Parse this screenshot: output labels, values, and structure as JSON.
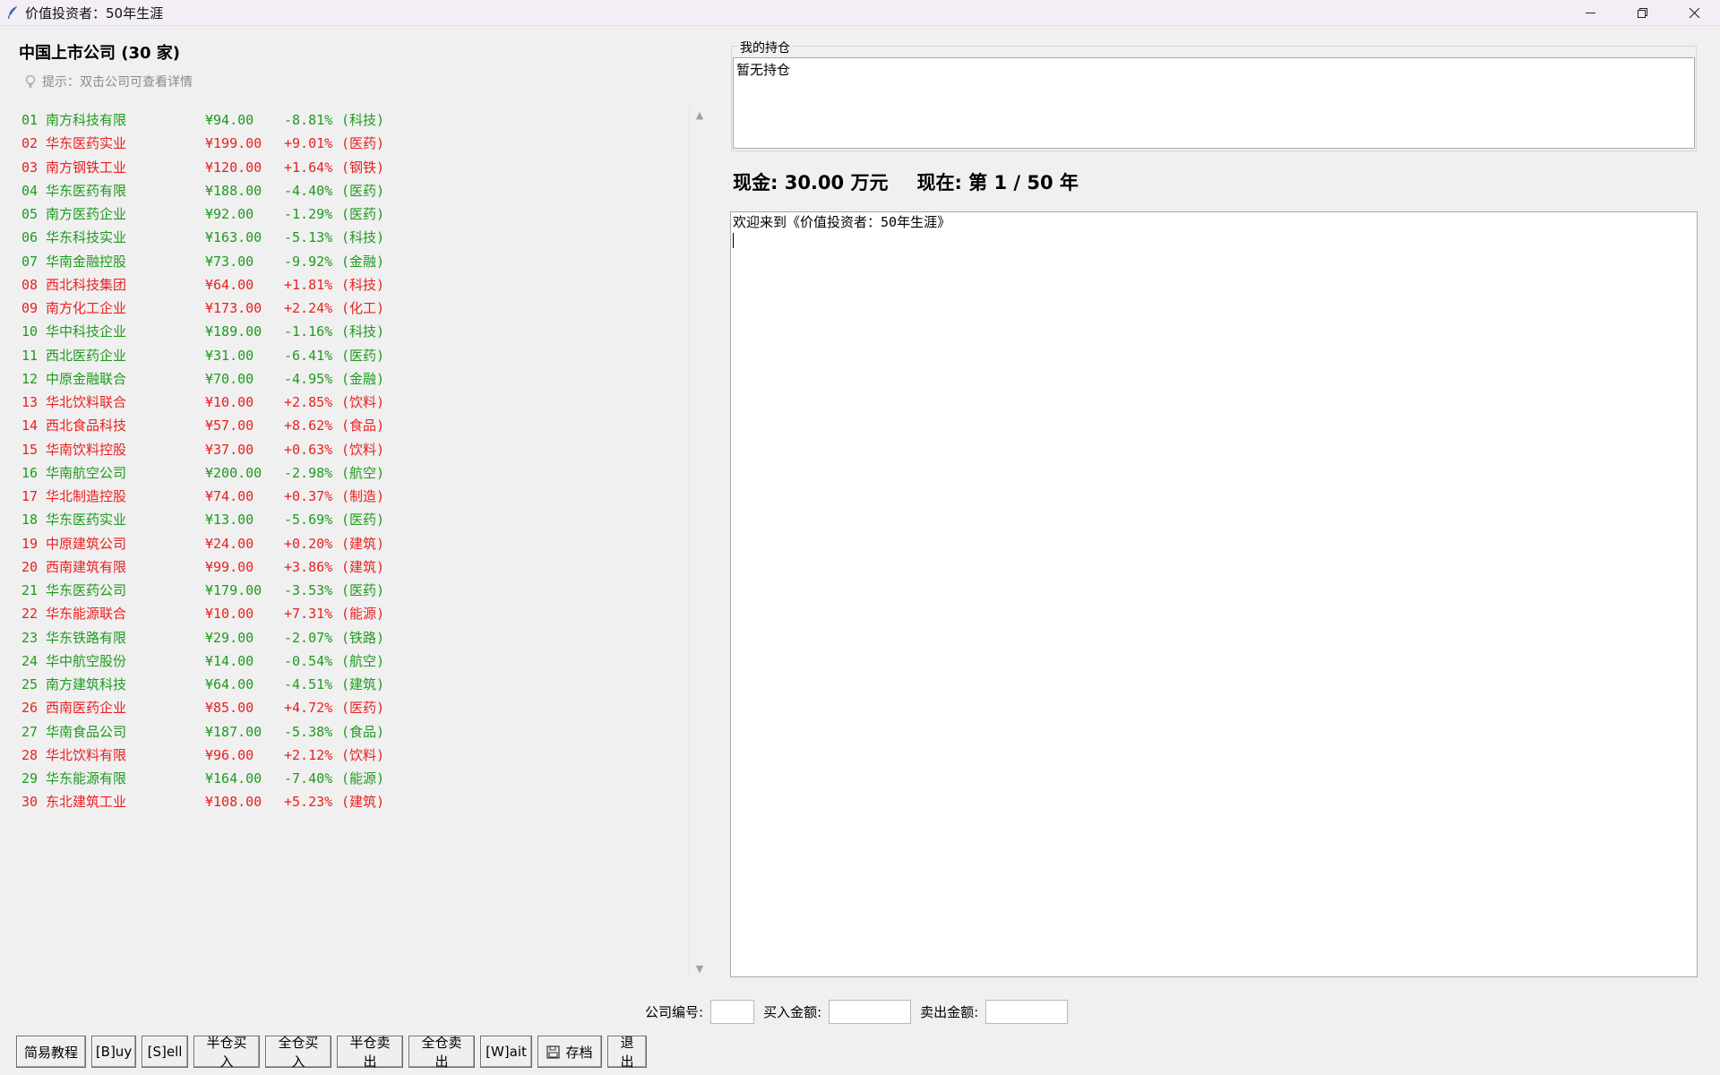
{
  "window": {
    "title": "价值投资者：50年生涯",
    "controls": {
      "minimize": "─",
      "maximize": "❐",
      "close": "✕"
    }
  },
  "list": {
    "title": "中国上市公司 (30 家)",
    "hint": "提示：双击公司可查看详情"
  },
  "companies": [
    {
      "code": "01",
      "name": "南方科技有限",
      "price": "¥94.00",
      "change": "-8.81%",
      "sector": "(科技)",
      "dir": "down"
    },
    {
      "code": "02",
      "name": "华东医药实业",
      "price": "¥199.00",
      "change": "+9.01%",
      "sector": "(医药)",
      "dir": "up"
    },
    {
      "code": "03",
      "name": "南方钢铁工业",
      "price": "¥120.00",
      "change": "+1.64%",
      "sector": "(钢铁)",
      "dir": "up"
    },
    {
      "code": "04",
      "name": "华东医药有限",
      "price": "¥188.00",
      "change": "-4.40%",
      "sector": "(医药)",
      "dir": "down"
    },
    {
      "code": "05",
      "name": "南方医药企业",
      "price": "¥92.00",
      "change": "-1.29%",
      "sector": "(医药)",
      "dir": "down"
    },
    {
      "code": "06",
      "name": "华东科技实业",
      "price": "¥163.00",
      "change": "-5.13%",
      "sector": "(科技)",
      "dir": "down"
    },
    {
      "code": "07",
      "name": "华南金融控股",
      "price": "¥73.00",
      "change": "-9.92%",
      "sector": "(金融)",
      "dir": "down"
    },
    {
      "code": "08",
      "name": "西北科技集团",
      "price": "¥64.00",
      "change": "+1.81%",
      "sector": "(科技)",
      "dir": "up"
    },
    {
      "code": "09",
      "name": "南方化工企业",
      "price": "¥173.00",
      "change": "+2.24%",
      "sector": "(化工)",
      "dir": "up"
    },
    {
      "code": "10",
      "name": "华中科技企业",
      "price": "¥189.00",
      "change": "-1.16%",
      "sector": "(科技)",
      "dir": "down"
    },
    {
      "code": "11",
      "name": "西北医药企业",
      "price": "¥31.00",
      "change": "-6.41%",
      "sector": "(医药)",
      "dir": "down"
    },
    {
      "code": "12",
      "name": "中原金融联合",
      "price": "¥70.00",
      "change": "-4.95%",
      "sector": "(金融)",
      "dir": "down"
    },
    {
      "code": "13",
      "name": "华北饮料联合",
      "price": "¥10.00",
      "change": "+2.85%",
      "sector": "(饮料)",
      "dir": "up"
    },
    {
      "code": "14",
      "name": "西北食品科技",
      "price": "¥57.00",
      "change": "+8.62%",
      "sector": "(食品)",
      "dir": "up"
    },
    {
      "code": "15",
      "name": "华南饮料控股",
      "price": "¥37.00",
      "change": "+0.63%",
      "sector": "(饮料)",
      "dir": "up"
    },
    {
      "code": "16",
      "name": "华南航空公司",
      "price": "¥200.00",
      "change": "-2.98%",
      "sector": "(航空)",
      "dir": "down"
    },
    {
      "code": "17",
      "name": "华北制造控股",
      "price": "¥74.00",
      "change": "+0.37%",
      "sector": "(制造)",
      "dir": "up"
    },
    {
      "code": "18",
      "name": "华东医药实业",
      "price": "¥13.00",
      "change": "-5.69%",
      "sector": "(医药)",
      "dir": "down"
    },
    {
      "code": "19",
      "name": "中原建筑公司",
      "price": "¥24.00",
      "change": "+0.20%",
      "sector": "(建筑)",
      "dir": "up"
    },
    {
      "code": "20",
      "name": "西南建筑有限",
      "price": "¥99.00",
      "change": "+3.86%",
      "sector": "(建筑)",
      "dir": "up"
    },
    {
      "code": "21",
      "name": "华东医药公司",
      "price": "¥179.00",
      "change": "-3.53%",
      "sector": "(医药)",
      "dir": "down"
    },
    {
      "code": "22",
      "name": "华东能源联合",
      "price": "¥10.00",
      "change": "+7.31%",
      "sector": "(能源)",
      "dir": "up"
    },
    {
      "code": "23",
      "name": "华东铁路有限",
      "price": "¥29.00",
      "change": "-2.07%",
      "sector": "(铁路)",
      "dir": "down"
    },
    {
      "code": "24",
      "name": "华中航空股份",
      "price": "¥14.00",
      "change": "-0.54%",
      "sector": "(航空)",
      "dir": "down"
    },
    {
      "code": "25",
      "name": "南方建筑科技",
      "price": "¥64.00",
      "change": "-4.51%",
      "sector": "(建筑)",
      "dir": "down"
    },
    {
      "code": "26",
      "name": "西南医药企业",
      "price": "¥85.00",
      "change": "+4.72%",
      "sector": "(医药)",
      "dir": "up"
    },
    {
      "code": "27",
      "name": "华南食品公司",
      "price": "¥187.00",
      "change": "-5.38%",
      "sector": "(食品)",
      "dir": "down"
    },
    {
      "code": "28",
      "name": "华北饮料有限",
      "price": "¥96.00",
      "change": "+2.12%",
      "sector": "(饮料)",
      "dir": "up"
    },
    {
      "code": "29",
      "name": "华东能源有限",
      "price": "¥164.00",
      "change": "-7.40%",
      "sector": "(能源)",
      "dir": "down"
    },
    {
      "code": "30",
      "name": "东北建筑工业",
      "price": "¥108.00",
      "change": "+5.23%",
      "sector": "(建筑)",
      "dir": "up"
    }
  ],
  "holdings": {
    "legend": "我的持仓",
    "content": "暂无持仓"
  },
  "status": {
    "cash": "现金: 30.00 万元",
    "year": "现在: 第 1 / 50 年"
  },
  "log": {
    "welcome": "欢迎来到《价值投资者：50年生涯》"
  },
  "form": {
    "code_label": "公司编号:",
    "code_value": "",
    "buy_label": "买入金额:",
    "buy_value": "",
    "sell_label": "卖出金额:",
    "sell_value": ""
  },
  "buttons": {
    "tutorial": "简易教程",
    "buy": "[B]uy",
    "sell": "[S]ell",
    "half_buy": "半仓买入",
    "full_buy": "全仓买入",
    "half_sell": "半仓卖出",
    "full_sell": "全仓卖出",
    "wait": "[W]ait",
    "save": "存档",
    "quit": "退出"
  },
  "colors": {
    "up": "#ea2020",
    "down": "#1e9b1e"
  },
  "icons": {
    "app": "feather-icon",
    "hint": "lightbulb-icon",
    "save": "floppy-disk-icon"
  }
}
